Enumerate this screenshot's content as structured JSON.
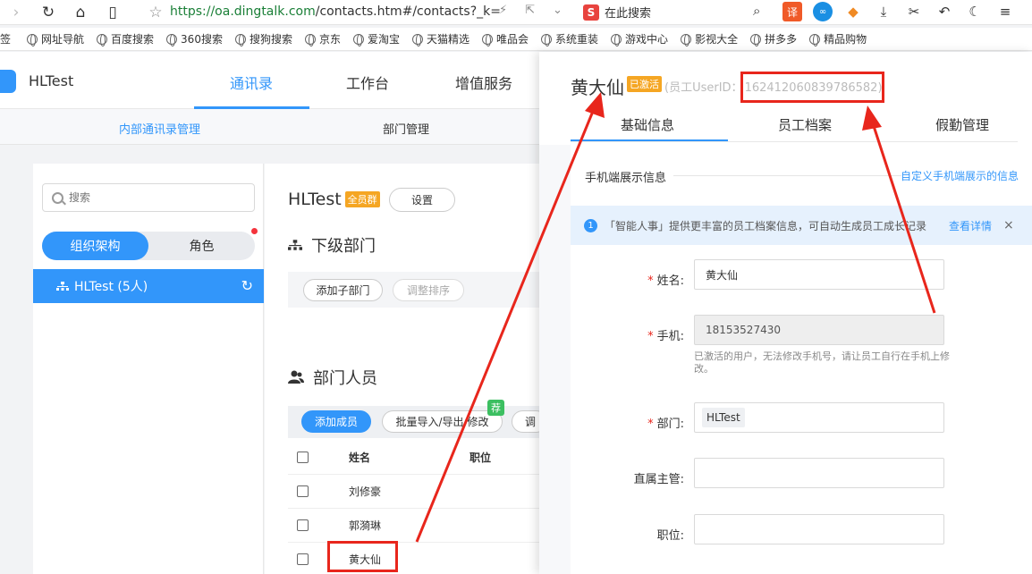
{
  "browser": {
    "url_host": "https://oa.dingtalk.com",
    "url_rest": "/contacts.htm#/contacts?_k=",
    "search_placeholder": "在此搜索",
    "search_engine_logo": "S",
    "ext_translate": "译",
    "bookmarks": [
      "签",
      "网址导航",
      "百度搜索",
      "360搜索",
      "搜狗搜索",
      "京东",
      "爱淘宝",
      "天猫精选",
      "唯品会",
      "系统重装",
      "游戏中心",
      "影视大全",
      "拼多多",
      "精品购物"
    ]
  },
  "app": {
    "title": "HLTest",
    "top_tabs": [
      "通讯录",
      "工作台",
      "增值服务"
    ],
    "sub_nav": [
      "内部通讯录管理",
      "部门管理"
    ]
  },
  "left": {
    "search_placeholder": "搜索",
    "seg_org": "组织架构",
    "seg_role": "角色",
    "tree_item": "HLTest (5人)"
  },
  "middle": {
    "dept_name": "HLTest",
    "dept_badge": "全员群",
    "settings": "设置",
    "sub_dept_title": "下级部门",
    "add_sub_dept": "添加子部门",
    "adjust_order": "调整排序",
    "members_title": "部门人员",
    "add_member": "添加成员",
    "batch_import": "批量导入/导出/修改",
    "rec_badge": "荐",
    "adjust_short": "调",
    "table_head": {
      "name": "姓名",
      "position": "职位"
    },
    "rows": [
      {
        "name": "刘修豪"
      },
      {
        "name": "郭漪琳"
      },
      {
        "name": "黄大仙"
      }
    ]
  },
  "drawer": {
    "name": "黄大仙",
    "status_badge": "已激活",
    "uid_label": "(员工UserID：",
    "uid_value": "16241206083978658​2)",
    "tabs": [
      "基础信息",
      "员工档案",
      "假勤管理"
    ],
    "section_title": "手机端展示信息",
    "section_link": "自定义手机端展示的信息",
    "notice_text": "「智能人事」提供更丰富的员工档案信息，可自动生成员工成长记录",
    "notice_link": "查看详情",
    "notice_close": "×",
    "fields": {
      "name_label": "姓名:",
      "name_value": "黄大仙",
      "phone_label": "手机:",
      "phone_value": "18153527430",
      "phone_hint": "已激活的用户，无法修改手机号，请让员工自行在手机上修改。",
      "dept_label": "部门:",
      "dept_value": "HLTest",
      "manager_label": "直属主管:",
      "position_label": "职位:"
    }
  }
}
